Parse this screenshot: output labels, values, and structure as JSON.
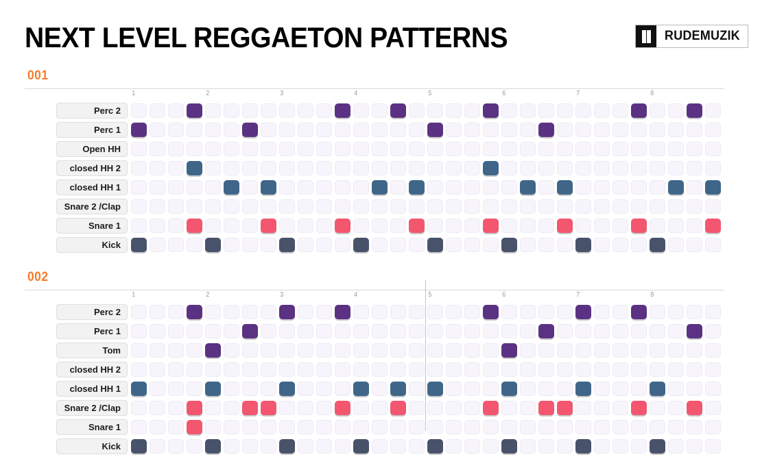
{
  "header": {
    "title": "NEXT LEVEL REGGAETON PATTERNS",
    "logo_text": "RUDEMUZIK",
    "logo_icon": "book-door-icon"
  },
  "colors": {
    "accent_orange": "#F47C2C",
    "perc_purple": "#5B3183",
    "hat_blue": "#3F6689",
    "snare_pink": "#F3566F",
    "kick_slate": "#49526B",
    "cell_empty": "#F7F5FB",
    "cell_border": "#ECEAF5",
    "label_bg": "#F2F2F2",
    "rule": "#D8D8D8",
    "ruler_text": "#9A9A9A",
    "playhead": "#C2C2C2"
  },
  "beat_numbers": [
    "1",
    "2",
    "3",
    "4",
    "5",
    "6",
    "7",
    "8"
  ],
  "steps_per_pattern": 32,
  "patterns": [
    {
      "id": "001",
      "playhead_step": null,
      "rows": [
        {
          "label": "Perc 2",
          "color": "#5B3183",
          "steps": [
            4,
            12,
            15,
            20,
            28,
            31
          ]
        },
        {
          "label": "Perc 1",
          "color": "#5B3183",
          "steps": [
            1,
            7,
            17,
            23
          ]
        },
        {
          "label": "Open HH",
          "color": "#3F6689",
          "steps": []
        },
        {
          "label": "closed HH 2",
          "color": "#3F6689",
          "steps": [
            4,
            20
          ]
        },
        {
          "label": "closed HH 1",
          "color": "#3F6689",
          "steps": [
            6,
            8,
            14,
            16,
            22,
            24,
            30,
            32
          ]
        },
        {
          "label": "Snare 2 /Clap",
          "color": "#F3566F",
          "steps": []
        },
        {
          "label": "Snare 1",
          "color": "#F3566F",
          "steps": [
            4,
            8,
            12,
            16,
            20,
            24,
            28,
            32
          ]
        },
        {
          "label": "Kick",
          "color": "#49526B",
          "steps": [
            1,
            5,
            9,
            13,
            17,
            21,
            25,
            29
          ]
        }
      ]
    },
    {
      "id": "002",
      "playhead_step": 17,
      "rows": [
        {
          "label": "Perc 2",
          "color": "#5B3183",
          "steps": [
            4,
            9,
            12,
            20,
            25,
            28
          ]
        },
        {
          "label": "Perc 1",
          "color": "#5B3183",
          "steps": [
            7,
            23,
            31
          ]
        },
        {
          "label": "Tom",
          "color": "#5B3183",
          "steps": [
            5,
            21
          ]
        },
        {
          "label": "closed HH 2",
          "color": "#3F6689",
          "steps": []
        },
        {
          "label": "closed HH 1",
          "color": "#3F6689",
          "steps": [
            1,
            5,
            9,
            13,
            15,
            17,
            21,
            25,
            29
          ]
        },
        {
          "label": "Snare 2 /Clap",
          "color": "#F3566F",
          "steps": [
            4,
            7,
            8,
            12,
            15,
            20,
            23,
            24,
            28,
            31
          ]
        },
        {
          "label": "Snare 1",
          "color": "#F3566F",
          "steps": [
            4
          ]
        },
        {
          "label": "Kick",
          "color": "#49526B",
          "steps": [
            1,
            5,
            9,
            13,
            17,
            21,
            25,
            29
          ]
        }
      ]
    }
  ]
}
